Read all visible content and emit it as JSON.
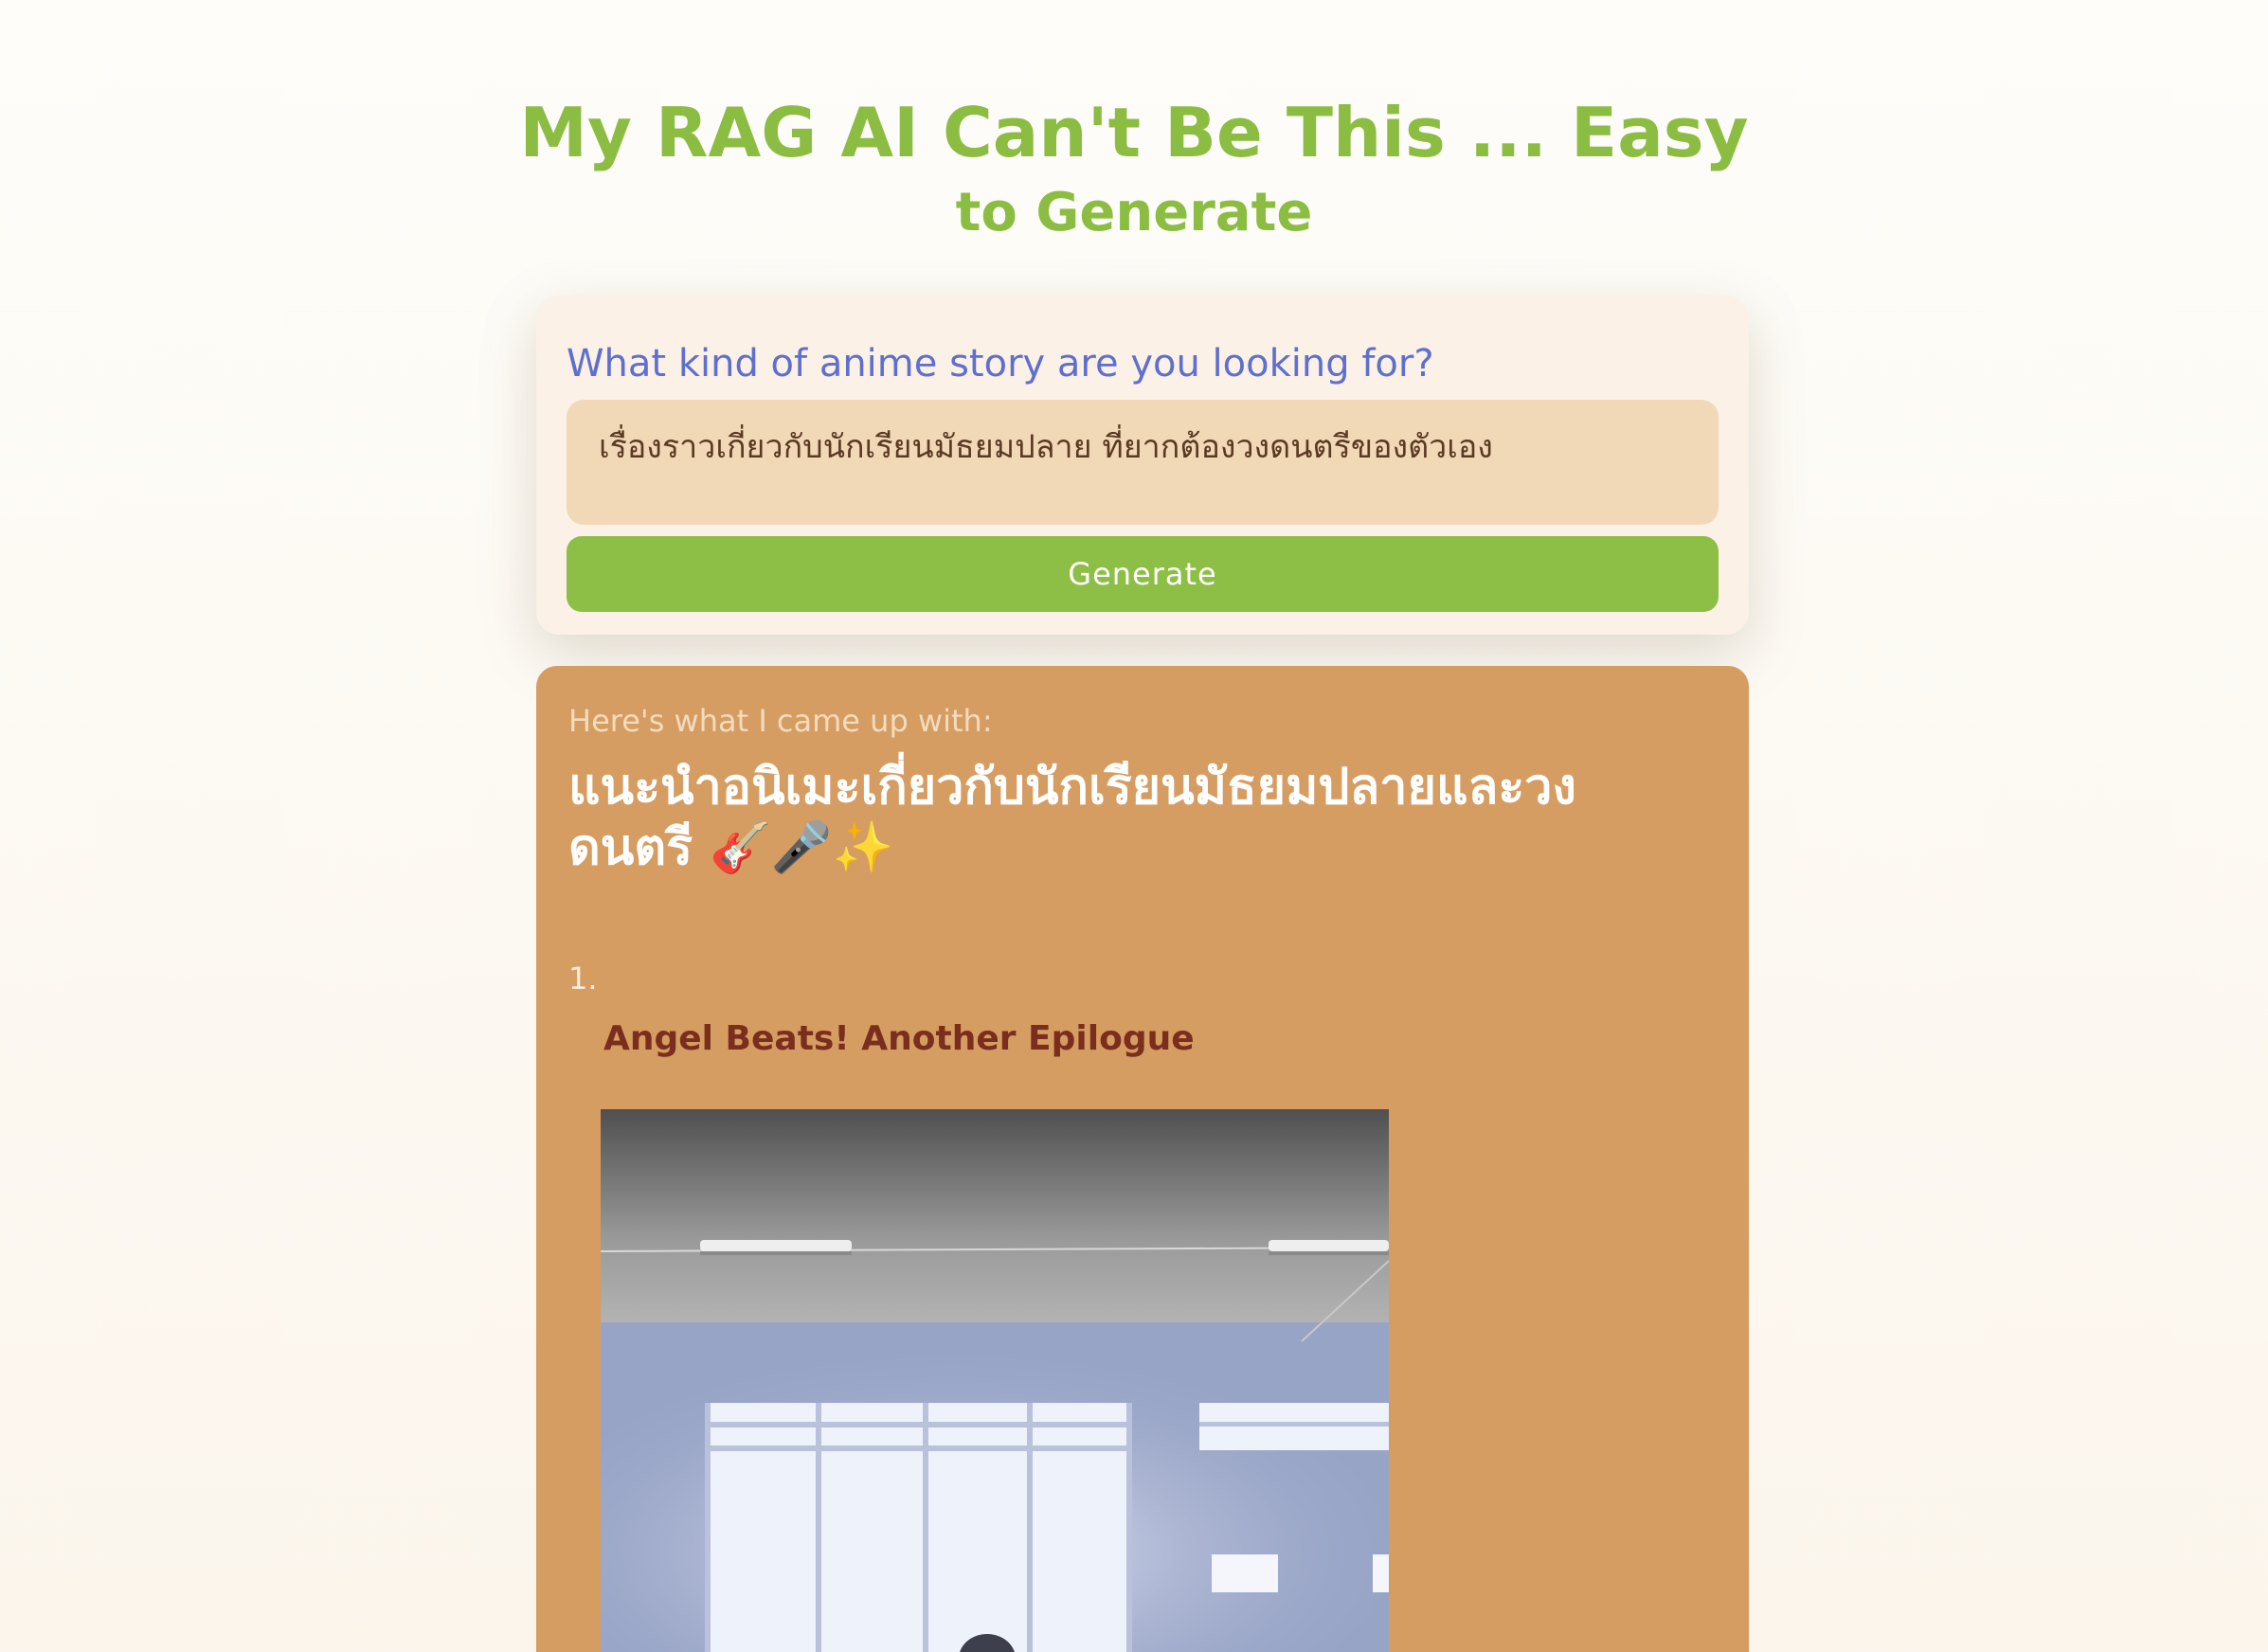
{
  "header": {
    "title_line1": "My RAG AI Can't Be This ... Easy",
    "title_line2": "to Generate"
  },
  "query": {
    "label": "What kind of anime story are you looking for?",
    "value": "เรื่องราวเกี่ยวกับนักเรียนมัธยมปลาย ที่ยากต้องวงดนตรีของตัวเอง",
    "button_label": "Generate"
  },
  "result": {
    "intro": "Here's what I came up with:",
    "heading": "แนะนำอนิเมะเกี่ยวกับนักเรียนมัธยมปลายและวงดนตรี 🎸🎤✨",
    "items": [
      {
        "number": "1.",
        "title": "Angel Beats! Another Epilogue",
        "image_icon": "classroom-image"
      }
    ]
  },
  "colors": {
    "accent_green": "#8dbe45",
    "query_label_blue": "#5e6fcf",
    "result_background": "#d69d62",
    "item_title": "#7a2e1e"
  }
}
